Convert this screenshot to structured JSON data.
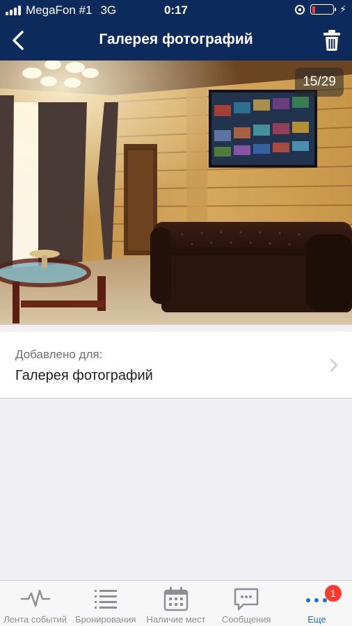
{
  "status_bar": {
    "carrier": "MegaFon #1",
    "network": "3G",
    "time": "0:17",
    "battery_percent": 15,
    "battery_color": "#ff3b30"
  },
  "nav": {
    "title": "Галерея фотографий",
    "back_icon": "chevron-left-icon",
    "trash_icon": "trash-icon",
    "background": "#0d2a5c"
  },
  "photo": {
    "counter": "15/29"
  },
  "added": {
    "label": "Добавлено для:",
    "value": "Галерея фотографий"
  },
  "tabs": [
    {
      "label": "Лента событий",
      "icon": "pulse-icon",
      "active": false
    },
    {
      "label": "Бронирования",
      "icon": "list-icon",
      "active": false
    },
    {
      "label": "Наличие мест",
      "icon": "calendar-icon",
      "active": false
    },
    {
      "label": "Сообщения",
      "icon": "chat-icon",
      "active": false
    },
    {
      "label": "Еще",
      "icon": "more-icon",
      "active": true,
      "badge": "1"
    }
  ],
  "accent_color": "#1e6fd9"
}
